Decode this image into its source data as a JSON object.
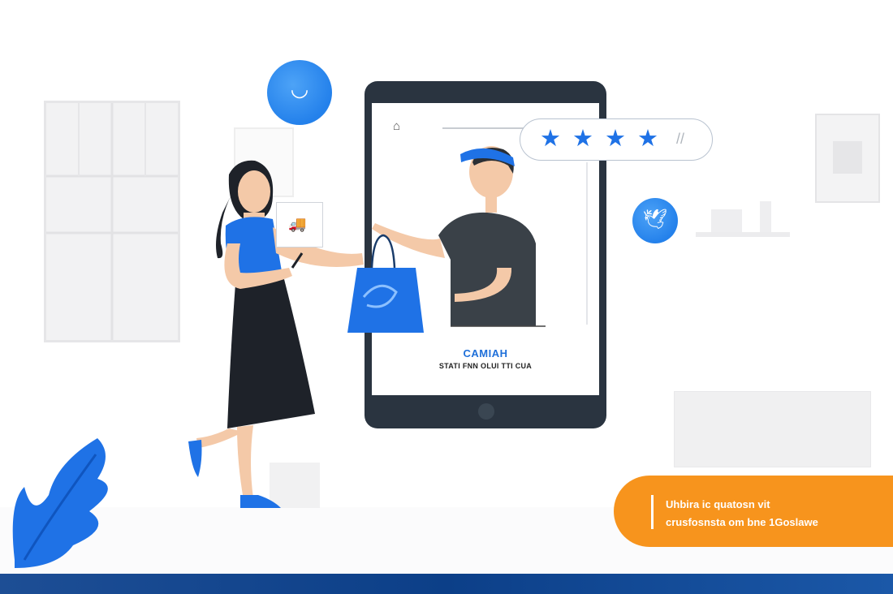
{
  "rating": {
    "stars": 4,
    "star_glyph": "★",
    "trailing_mark": "//"
  },
  "screen": {
    "caption_title": "CAMIAH",
    "caption_subtitle": "STATI FNN OLUI TTI CUA",
    "home_icon": "⌂"
  },
  "banner": {
    "line1": "Uhbira ic quatosn vit",
    "line2": "crusfosnsta om bne 1Goslawe"
  },
  "icons": {
    "bubble_top": "smile-icon",
    "bubble_right": "bird-icon",
    "speech": "truck-icon"
  },
  "colors": {
    "accent_blue": "#1f72e6",
    "banner_orange": "#f7941d",
    "tablet_frame": "#2a3440",
    "bottom_bar": "#0c3f88"
  }
}
